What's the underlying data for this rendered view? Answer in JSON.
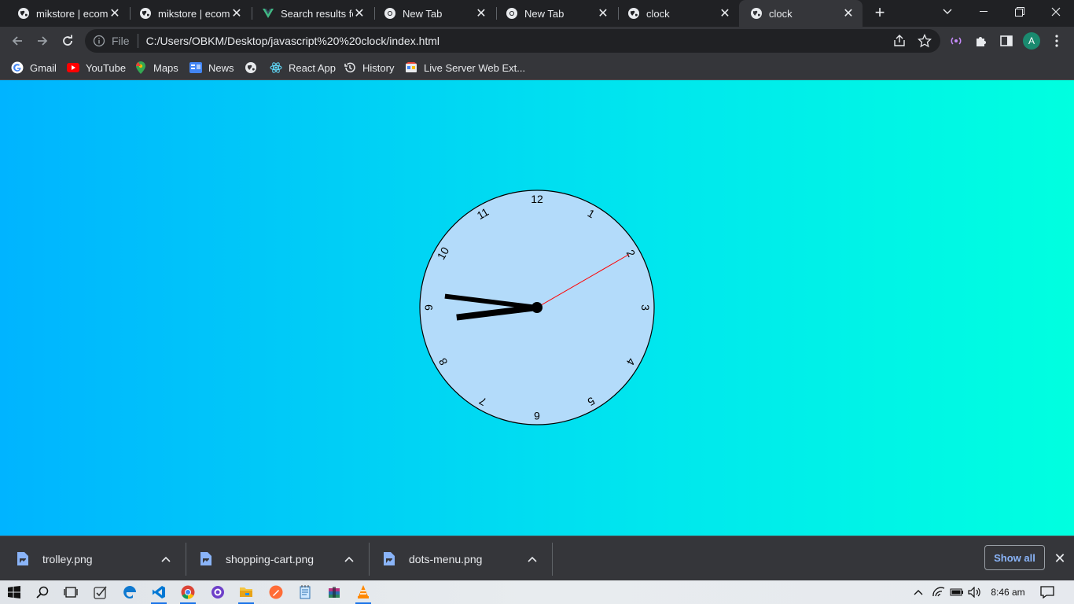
{
  "tabs": [
    {
      "title": "mikstore | ecomm",
      "icon": "globe-icon"
    },
    {
      "title": "mikstore | ecomm",
      "icon": "globe-icon"
    },
    {
      "title": "Search results for",
      "icon": "vue-icon"
    },
    {
      "title": "New Tab",
      "icon": "chrome-icon"
    },
    {
      "title": "New Tab",
      "icon": "chrome-icon"
    },
    {
      "title": "clock",
      "icon": "globe-icon"
    },
    {
      "title": "clock",
      "icon": "globe-icon",
      "active": true
    }
  ],
  "address": {
    "scheme": "File",
    "url": "C:/Users/OBKM/Desktop/javascript%20%20clock/index.html"
  },
  "profile": {
    "initial": "A"
  },
  "bookmarks": [
    {
      "label": "Gmail",
      "icon": "google-icon"
    },
    {
      "label": "YouTube",
      "icon": "youtube-icon"
    },
    {
      "label": "Maps",
      "icon": "maps-icon"
    },
    {
      "label": "News",
      "icon": "news-icon"
    },
    {
      "label": "",
      "icon": "globe-icon"
    },
    {
      "label": "React App",
      "icon": "react-icon"
    },
    {
      "label": "History",
      "icon": "history-icon"
    },
    {
      "label": "Live Server Web Ext...",
      "icon": "live-server-icon"
    }
  ],
  "clock": {
    "numbers": [
      "12",
      "1",
      "2",
      "3",
      "4",
      "5",
      "6",
      "7",
      "8",
      "9",
      "10",
      "11"
    ],
    "time": {
      "hour": 8,
      "minute": 46,
      "second": 10
    },
    "colors": {
      "face": "#b3dbfa",
      "hands": "#000000",
      "second_hand": "#ff0000"
    }
  },
  "downloads": {
    "files": [
      {
        "name": "trolley.png"
      },
      {
        "name": "shopping-cart.png"
      },
      {
        "name": "dots-menu.png"
      }
    ],
    "show_all": "Show all"
  },
  "taskbar": {
    "time": "8:46 am",
    "apps": [
      "windows-start-icon",
      "search-icon",
      "task-view-icon",
      "todo-icon",
      "edge-icon",
      "vscode-icon",
      "chrome-icon",
      "github-desktop-icon",
      "file-explorer-icon",
      "postman-icon",
      "notepad-icon",
      "winrar-icon",
      "vlc-icon"
    ]
  },
  "colors": {
    "accent": "#8ab4f8",
    "page_gradient_start": "#00b4ff",
    "page_gradient_end": "#00ffe0"
  }
}
